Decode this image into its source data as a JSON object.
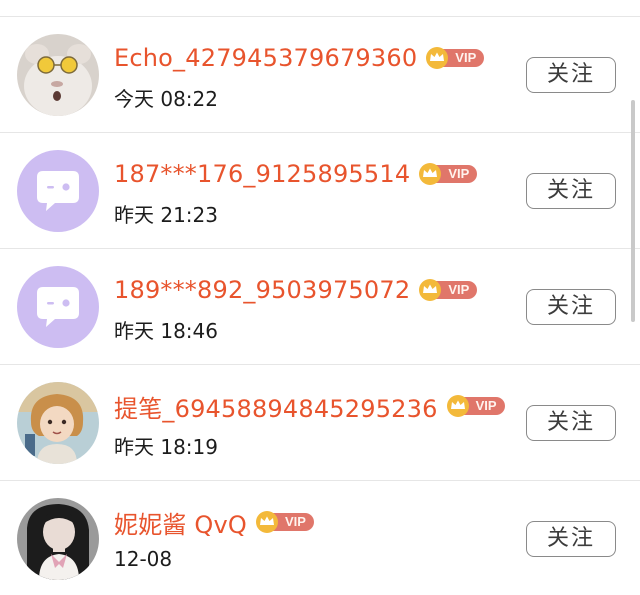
{
  "icons": {
    "vip": "crown-icon",
    "default_avatar": "chat-bubble-icon"
  },
  "colors": {
    "username": "#e8542d",
    "vip_pill": "#e0766a",
    "vip_crown": "#f3b93a",
    "default_avatar_bg": "#cdbdf2"
  },
  "users": [
    {
      "name": "Echo_427945379679360",
      "vip": "VIP",
      "time": "今天 08:22",
      "follow": "关注",
      "avatar": "cat-photo"
    },
    {
      "name": "187***176_9125895514",
      "vip": "VIP",
      "time": "昨天 21:23",
      "follow": "关注",
      "avatar": "default-chat"
    },
    {
      "name": "189***892_9503975072",
      "vip": "VIP",
      "time": "昨天 18:46",
      "follow": "关注",
      "avatar": "default-chat"
    },
    {
      "name": "提笔_69458894845295236",
      "vip": "VIP",
      "time": "昨天 18:19",
      "follow": "关注",
      "avatar": "cartoon-girl"
    },
    {
      "name": "妮妮酱 QvQ",
      "vip": "VIP",
      "time": "12-08",
      "follow": "关注",
      "avatar": "girl-photo"
    }
  ]
}
